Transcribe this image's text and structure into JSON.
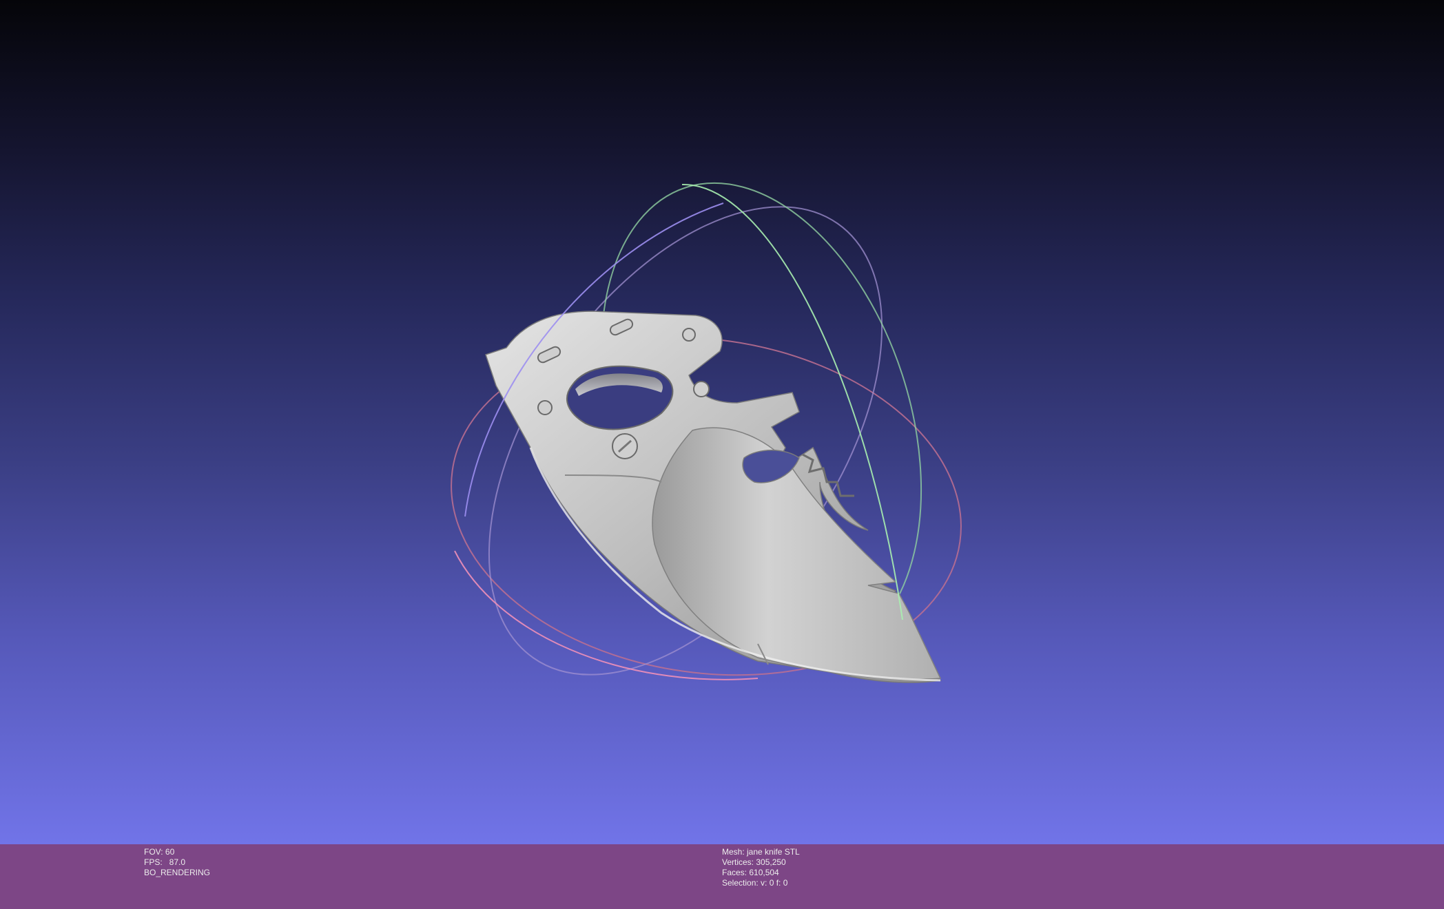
{
  "viewer": {
    "background_top": "#050509",
    "background_bottom": "#7174e8",
    "model": "knife-mesh",
    "trackball": {
      "ring_x_color": "#e070a0",
      "ring_y_color": "#8de6a0",
      "ring_z_color": "#9890e8"
    }
  },
  "status_bar": {
    "color": "#7d4686",
    "left": {
      "fov": "FOV: 60",
      "fps": "FPS:   87.0",
      "mode": "BO_RENDERING"
    },
    "right": {
      "mesh": "Mesh: jane knife STL",
      "vertices": "Vertices: 305,250",
      "faces": "Faces: 610,504",
      "selection": "Selection: v: 0 f: 0"
    }
  }
}
